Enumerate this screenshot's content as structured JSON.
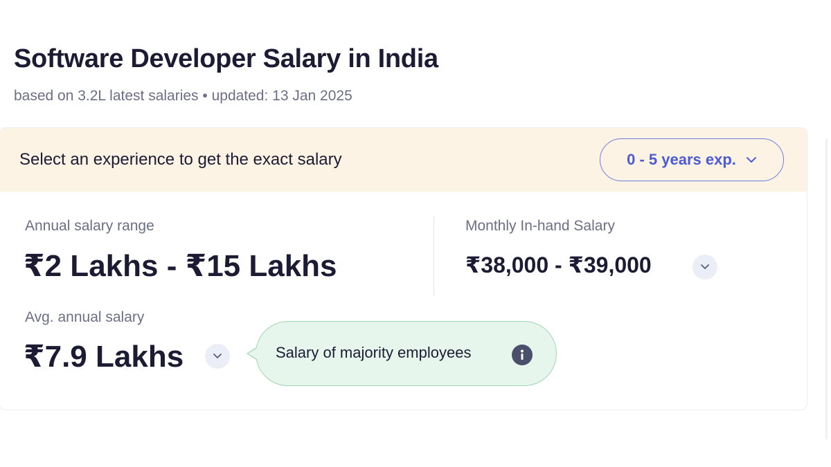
{
  "header": {
    "title": "Software Developer Salary in India",
    "subtitle": "based on 3.2L latest salaries • updated: 13 Jan 2025"
  },
  "experience": {
    "prompt": "Select an experience to get the exact salary",
    "selected": "0 - 5 years exp."
  },
  "annual_range": {
    "label": "Annual salary range",
    "value": "₹2 Lakhs - ₹15 Lakhs"
  },
  "monthly": {
    "label": "Monthly In-hand Salary",
    "value": "₹38,000 - ₹39,000"
  },
  "average": {
    "label": "Avg. annual salary",
    "value": "₹7.9 Lakhs"
  },
  "tooltip": {
    "text": "Salary of majority employees"
  },
  "colors": {
    "accent": "#4a5bd4",
    "header_bg": "#fdf3e4",
    "tooltip_bg": "#e6f6ed"
  },
  "icons": {
    "dropdown": "chevron-down-icon",
    "info": "info-icon"
  }
}
